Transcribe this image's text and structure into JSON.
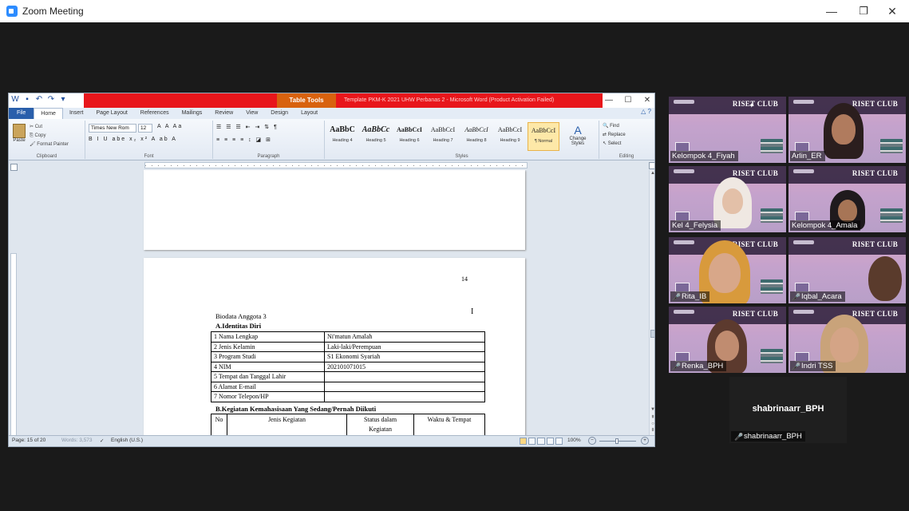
{
  "zoom": {
    "title": "Zoom Meeting",
    "minimize": "—",
    "maximize": "❐",
    "close": "✕"
  },
  "word": {
    "doc_title": "Template PKM-K 2021 UHW Perbanas 2 - Microsoft Word (Product Activation Failed)",
    "table_tools": "Table Tools",
    "window_controls": [
      "—",
      "☐",
      "✕"
    ],
    "tabs": [
      "File",
      "Home",
      "Insert",
      "Page Layout",
      "References",
      "Mailings",
      "Review",
      "View",
      "Design",
      "Layout"
    ],
    "active_tab": "Home",
    "clipboard": {
      "paste": "Paste",
      "cut": "Cut",
      "copy": "Copy",
      "format_painter": "Format Painter",
      "label": "Clipboard"
    },
    "font": {
      "name": "Times New Rom",
      "size": "12",
      "row1_extra": "A  A   Aa",
      "row2": "B  I  U  abe  x₂  x²   A  ab  A",
      "label": "Font"
    },
    "paragraph": {
      "row1": "☰ ☰ ☰   ⇤ ⇥   ⇅   ¶",
      "row2": "≡ ≡ ≡ ≡   ↕   ◪  ⊞",
      "label": "Paragraph"
    },
    "styles": {
      "label": "Styles",
      "items": [
        {
          "sample": "AaBbC",
          "name": "Heading 4"
        },
        {
          "sample": "AaBbCc",
          "name": "Heading 5"
        },
        {
          "sample": "AaBbCcI",
          "name": "Heading 6"
        },
        {
          "sample": "AaBbCcI",
          "name": "Heading 7"
        },
        {
          "sample": "AaBbCcI",
          "name": "Heading 8"
        },
        {
          "sample": "AaBbCcI",
          "name": "Heading 9"
        },
        {
          "sample": "AaBbCcI",
          "name": "¶ Normal"
        }
      ],
      "change_styles": "Change Styles"
    },
    "editing": {
      "find": "Find",
      "replace": "Replace",
      "select": "Select",
      "label": "Editing"
    },
    "page": {
      "number": "14",
      "bio_title": "Biodata Anggota 3",
      "section_a": "A.Identitas Diri",
      "identity_rows": [
        [
          "1 Nama Lengkap",
          "Ni'matun Amalah"
        ],
        [
          "2 Jenis Kelamin",
          "Laki-laki/Perempuan"
        ],
        [
          "3 Program Studi",
          "S1 Ekonomi Syariah"
        ],
        [
          "4 NIM",
          "202101071015"
        ],
        [
          "5 Tempat dan Tanggal Lahir",
          ""
        ],
        [
          "6 Alamat E-mail",
          ""
        ],
        [
          "7 Nomor Telepon/HP",
          ""
        ]
      ],
      "section_b": "B.Kegiatan Kemahasisaan Yang Sedang/Pernah Diikuti",
      "activity_headers": [
        "No",
        "Jenis Kegiatan",
        "Status dalam Kegiatan",
        "Waktu & Tempat"
      ]
    },
    "status": {
      "page": "Page: 15 of 20",
      "words": "Words: 3,573",
      "language": "English (U.S.)",
      "zoom": "100%"
    }
  },
  "participants": [
    {
      "name": "Kelompok 4_Fiyah",
      "muted": false
    },
    {
      "name": "Arlin_ER",
      "muted": false
    },
    {
      "name": "Kel 4_Felysia",
      "muted": false
    },
    {
      "name": "Kelompok 4_Amala",
      "muted": false
    },
    {
      "name": "Rita_IB",
      "muted": true
    },
    {
      "name": "Iqbal_Acara",
      "muted": true
    },
    {
      "name": "Renka_BPH",
      "muted": true
    },
    {
      "name": "Indri TSS",
      "muted": true
    },
    {
      "name": "shabrinaarr_BPH",
      "muted": true
    }
  ],
  "tile_brand": "RISET CLUB",
  "colors": {
    "accent_speaker": "#b4e36b",
    "word_titlebar_red": "#e8161b",
    "word_file_tab": "#2a5fab",
    "mic_off": "#e02828"
  }
}
